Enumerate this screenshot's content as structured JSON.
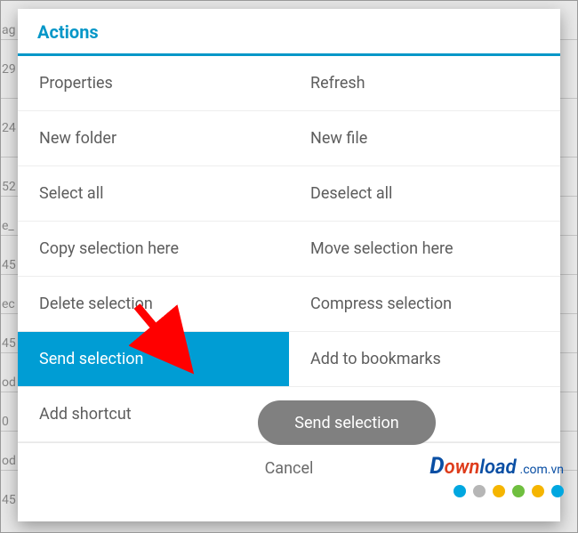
{
  "dialog": {
    "title": "Actions",
    "rows": [
      {
        "left": "Properties",
        "right": "Refresh"
      },
      {
        "left": "New folder",
        "right": "New file"
      },
      {
        "left": "Select all",
        "right": "Deselect all"
      },
      {
        "left": "Copy selection here",
        "right": "Move selection here"
      },
      {
        "left": "Delete selection",
        "right": "Compress selection"
      },
      {
        "left": "Send selection",
        "right": "Add to bookmarks",
        "leftSelected": true
      },
      {
        "left": "Add shortcut",
        "right": ""
      }
    ],
    "cancel": "Cancel"
  },
  "toast": {
    "text": "Send selection"
  },
  "background": {
    "fragments": [
      "ag",
      "29",
      "24",
      "52",
      "e_",
      "45",
      "ec",
      "45",
      "od",
      "0",
      "od",
      "45"
    ]
  },
  "watermark": {
    "parts": {
      "d": "D",
      "own": "own",
      "load": "load",
      "suffix": ".com.vn"
    },
    "dotColors": [
      "#00a7e0",
      "#b6b6b6",
      "#f5b500",
      "#6fbf3f",
      "#f5b500",
      "#00a7e0"
    ]
  },
  "arrow": {
    "color": "#ff0000"
  }
}
